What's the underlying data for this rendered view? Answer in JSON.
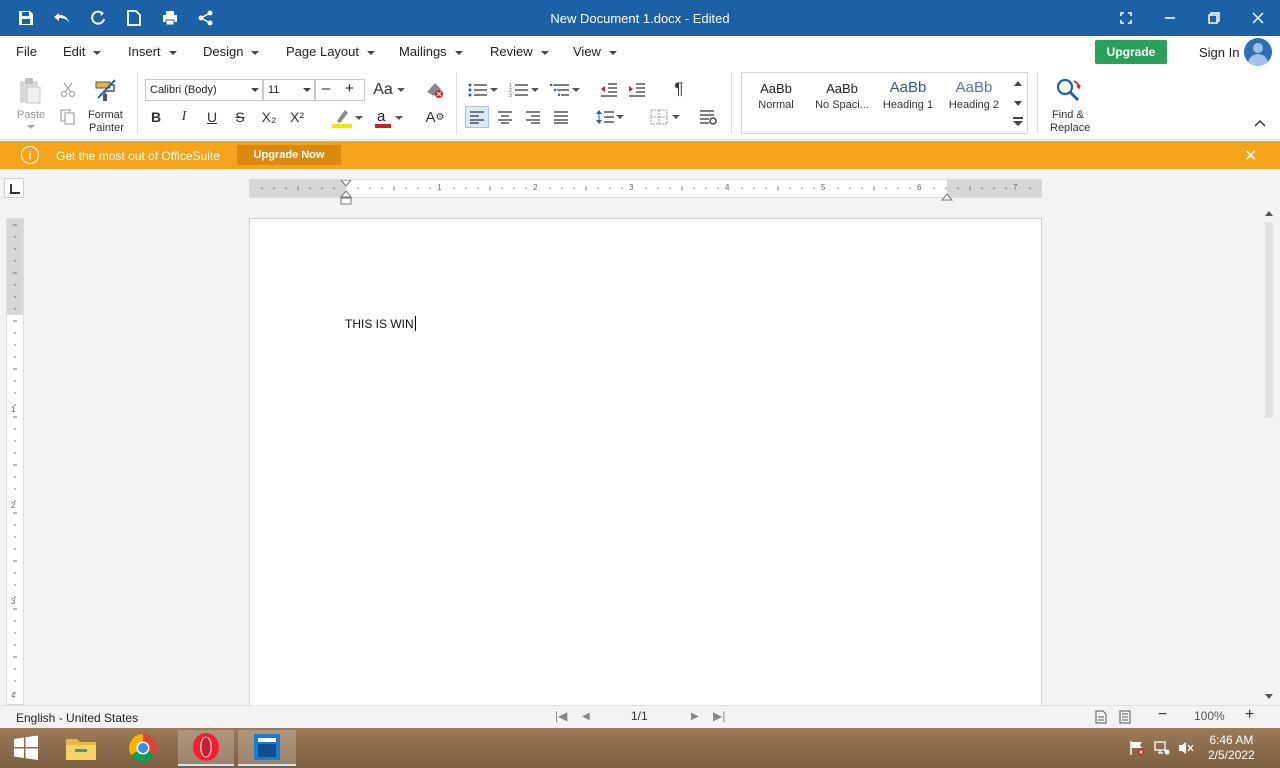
{
  "titlebar": {
    "title": "New Document 1.docx - Edited"
  },
  "menu": {
    "items": [
      "File",
      "Edit",
      "Insert",
      "Design",
      "Page Layout",
      "Mailings",
      "Review",
      "View"
    ],
    "upgrade_label": "Upgrade",
    "signin_label": "Sign In"
  },
  "ribbon": {
    "paste_label": "Paste",
    "format_painter_label_1": "Format",
    "format_painter_label_2": "Painter",
    "font_name": "Calibri (Body)",
    "font_size": "11",
    "bold": "B",
    "italic": "I",
    "underline": "U",
    "strike": "S",
    "subscript": "X₂",
    "superscript": "X²",
    "font_case": "Aa",
    "pilcrow": "¶",
    "find_label_1": "Find &",
    "find_label_2": "Replace",
    "styles": [
      {
        "sample": "AaBb",
        "name": "Normal"
      },
      {
        "sample": "AaBb",
        "name": "No Spaci..."
      },
      {
        "sample": "AaBb",
        "name": "Heading 1"
      },
      {
        "sample": "AaBb",
        "name": "Heading 2"
      }
    ]
  },
  "notification": {
    "message": "Get the most out of OfficeSuite",
    "button": "Upgrade Now"
  },
  "ruler": {
    "h_numbers": [
      "1",
      "2",
      "3",
      "4",
      "5",
      "6",
      "7"
    ],
    "v_numbers": [
      "1",
      "2",
      "3",
      "4"
    ]
  },
  "document": {
    "text": "THIS IS WIN"
  },
  "status": {
    "language": "English - United States",
    "page": "1/1",
    "zoom": "100%"
  },
  "taskbar": {
    "time": "6:46 AM",
    "date": "2/5/2022"
  },
  "colors": {
    "titlebar": "#1c61a6",
    "upgrade": "#2aa15a",
    "notification": "#f5a31a",
    "highlight": "#f2e600",
    "font_color": "#d11e1e"
  }
}
